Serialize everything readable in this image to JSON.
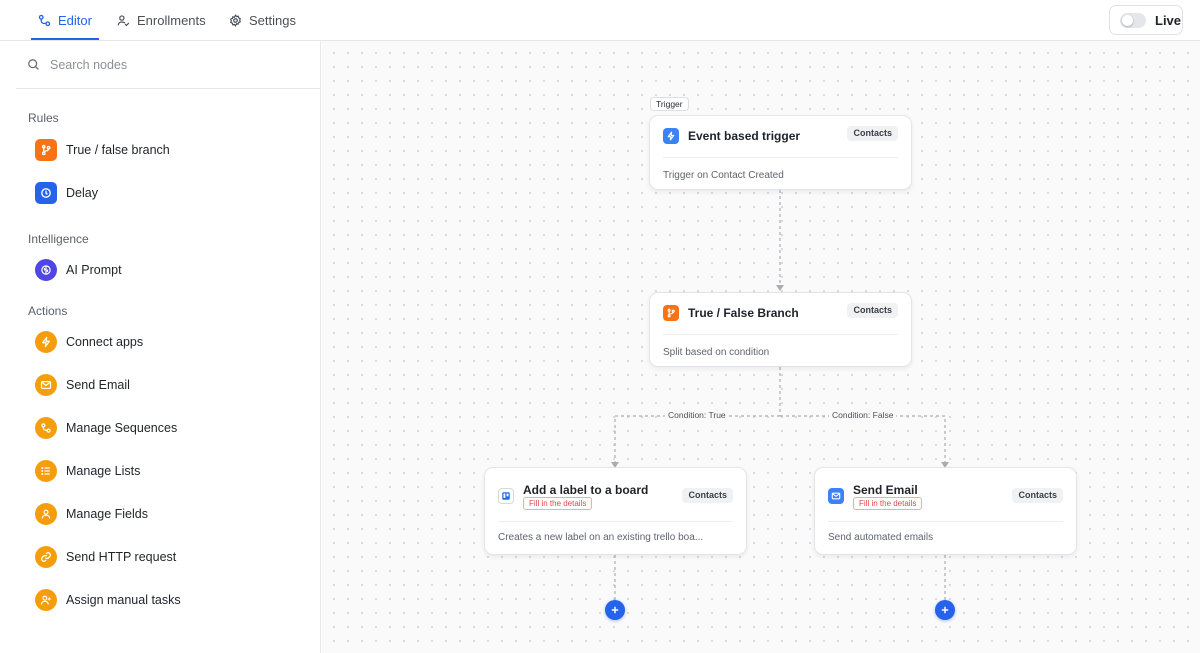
{
  "tabs": [
    {
      "label": "Editor",
      "icon": "flow-icon",
      "active": true
    },
    {
      "label": "Enrollments",
      "icon": "user-check-icon"
    },
    {
      "label": "Settings",
      "icon": "gear-icon"
    }
  ],
  "live_toggle": {
    "label": "Live",
    "on": false
  },
  "search": {
    "placeholder": "Search nodes"
  },
  "sidebar": {
    "sections": [
      {
        "title": "Rules",
        "items": [
          {
            "label": "True / false branch",
            "icon": "branch-icon",
            "color": "#f97316"
          },
          {
            "label": "Delay",
            "icon": "clock-icon",
            "color": "#2563eb"
          }
        ]
      },
      {
        "title": "Intelligence",
        "items": [
          {
            "label": "AI Prompt",
            "icon": "ai-icon",
            "color": "#4f46e5"
          }
        ]
      },
      {
        "title": "Actions",
        "items": [
          {
            "label": "Connect apps",
            "icon": "bolt-icon",
            "color": "#f59e0b"
          },
          {
            "label": "Send Email",
            "icon": "mail-icon",
            "color": "#f59e0b"
          },
          {
            "label": "Manage Sequences",
            "icon": "sequence-icon",
            "color": "#f59e0b"
          },
          {
            "label": "Manage Lists",
            "icon": "list-icon",
            "color": "#f59e0b"
          },
          {
            "label": "Manage Fields",
            "icon": "user-icon",
            "color": "#f59e0b"
          },
          {
            "label": "Send HTTP request",
            "icon": "link-icon",
            "color": "#f59e0b"
          },
          {
            "label": "Assign manual tasks",
            "icon": "user-plus-icon",
            "color": "#f59e0b"
          }
        ]
      }
    ]
  },
  "canvas": {
    "trigger_tag": "Trigger",
    "nodes": {
      "trigger": {
        "title": "Event based trigger",
        "chip": "Contacts",
        "description": "Trigger on Contact Created",
        "icon": "bolt-icon",
        "color": "#3b82f6"
      },
      "branch": {
        "title": "True / False Branch",
        "chip": "Contacts",
        "description": "Split based on condition",
        "icon": "branch-icon",
        "color": "#f97316"
      },
      "trello": {
        "title": "Add a label to a board",
        "chip": "Contacts",
        "warning": "Fill in the details",
        "description": "Creates a new label on an existing trello boa...",
        "icon": "trello-icon",
        "color": "#1d6fe0"
      },
      "email": {
        "title": "Send Email",
        "chip": "Contacts",
        "warning": "Fill in the details",
        "description": "Send automated emails",
        "icon": "mail-icon",
        "color": "#3b82f6"
      }
    },
    "conditions": {
      "true_label": "Condition: True",
      "false_label": "Condition: False"
    }
  },
  "colors": {
    "accent": "#2563eb",
    "warning": "#e04848"
  }
}
